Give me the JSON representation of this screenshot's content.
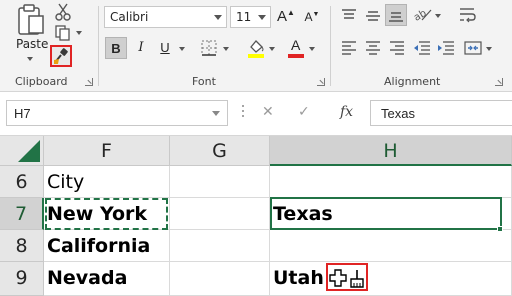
{
  "ribbon": {
    "clipboard": {
      "label": "Clipboard",
      "paste_label": "Paste",
      "icons": [
        "paste-icon",
        "cut-icon",
        "copy-icon",
        "format-painter-icon"
      ]
    },
    "font": {
      "label": "Font",
      "font_name": "Calibri",
      "font_size": "11",
      "grow_font": "A",
      "shrink_font": "A",
      "bold": "B",
      "italic": "I",
      "underline": "U",
      "font_color_letter": "A",
      "highlight_color": "#ffff00",
      "font_color": "#e02424"
    },
    "alignment": {
      "label": "Alignment"
    }
  },
  "formula_bar": {
    "name_box": "H7",
    "fx": "fx",
    "value": "Texas"
  },
  "grid": {
    "columns": [
      "F",
      "G",
      "H"
    ],
    "active_column": "H",
    "rows": [
      {
        "num": "6",
        "F": "City",
        "G": "",
        "H": ""
      },
      {
        "num": "7",
        "F": "New York",
        "G": "",
        "H": "Texas"
      },
      {
        "num": "8",
        "F": "California",
        "G": "",
        "H": ""
      },
      {
        "num": "9",
        "F": "Nevada",
        "G": "",
        "H": "Utah"
      }
    ],
    "active_row": "7",
    "accent_color": "#217346",
    "highlight_color": "#e02424"
  }
}
